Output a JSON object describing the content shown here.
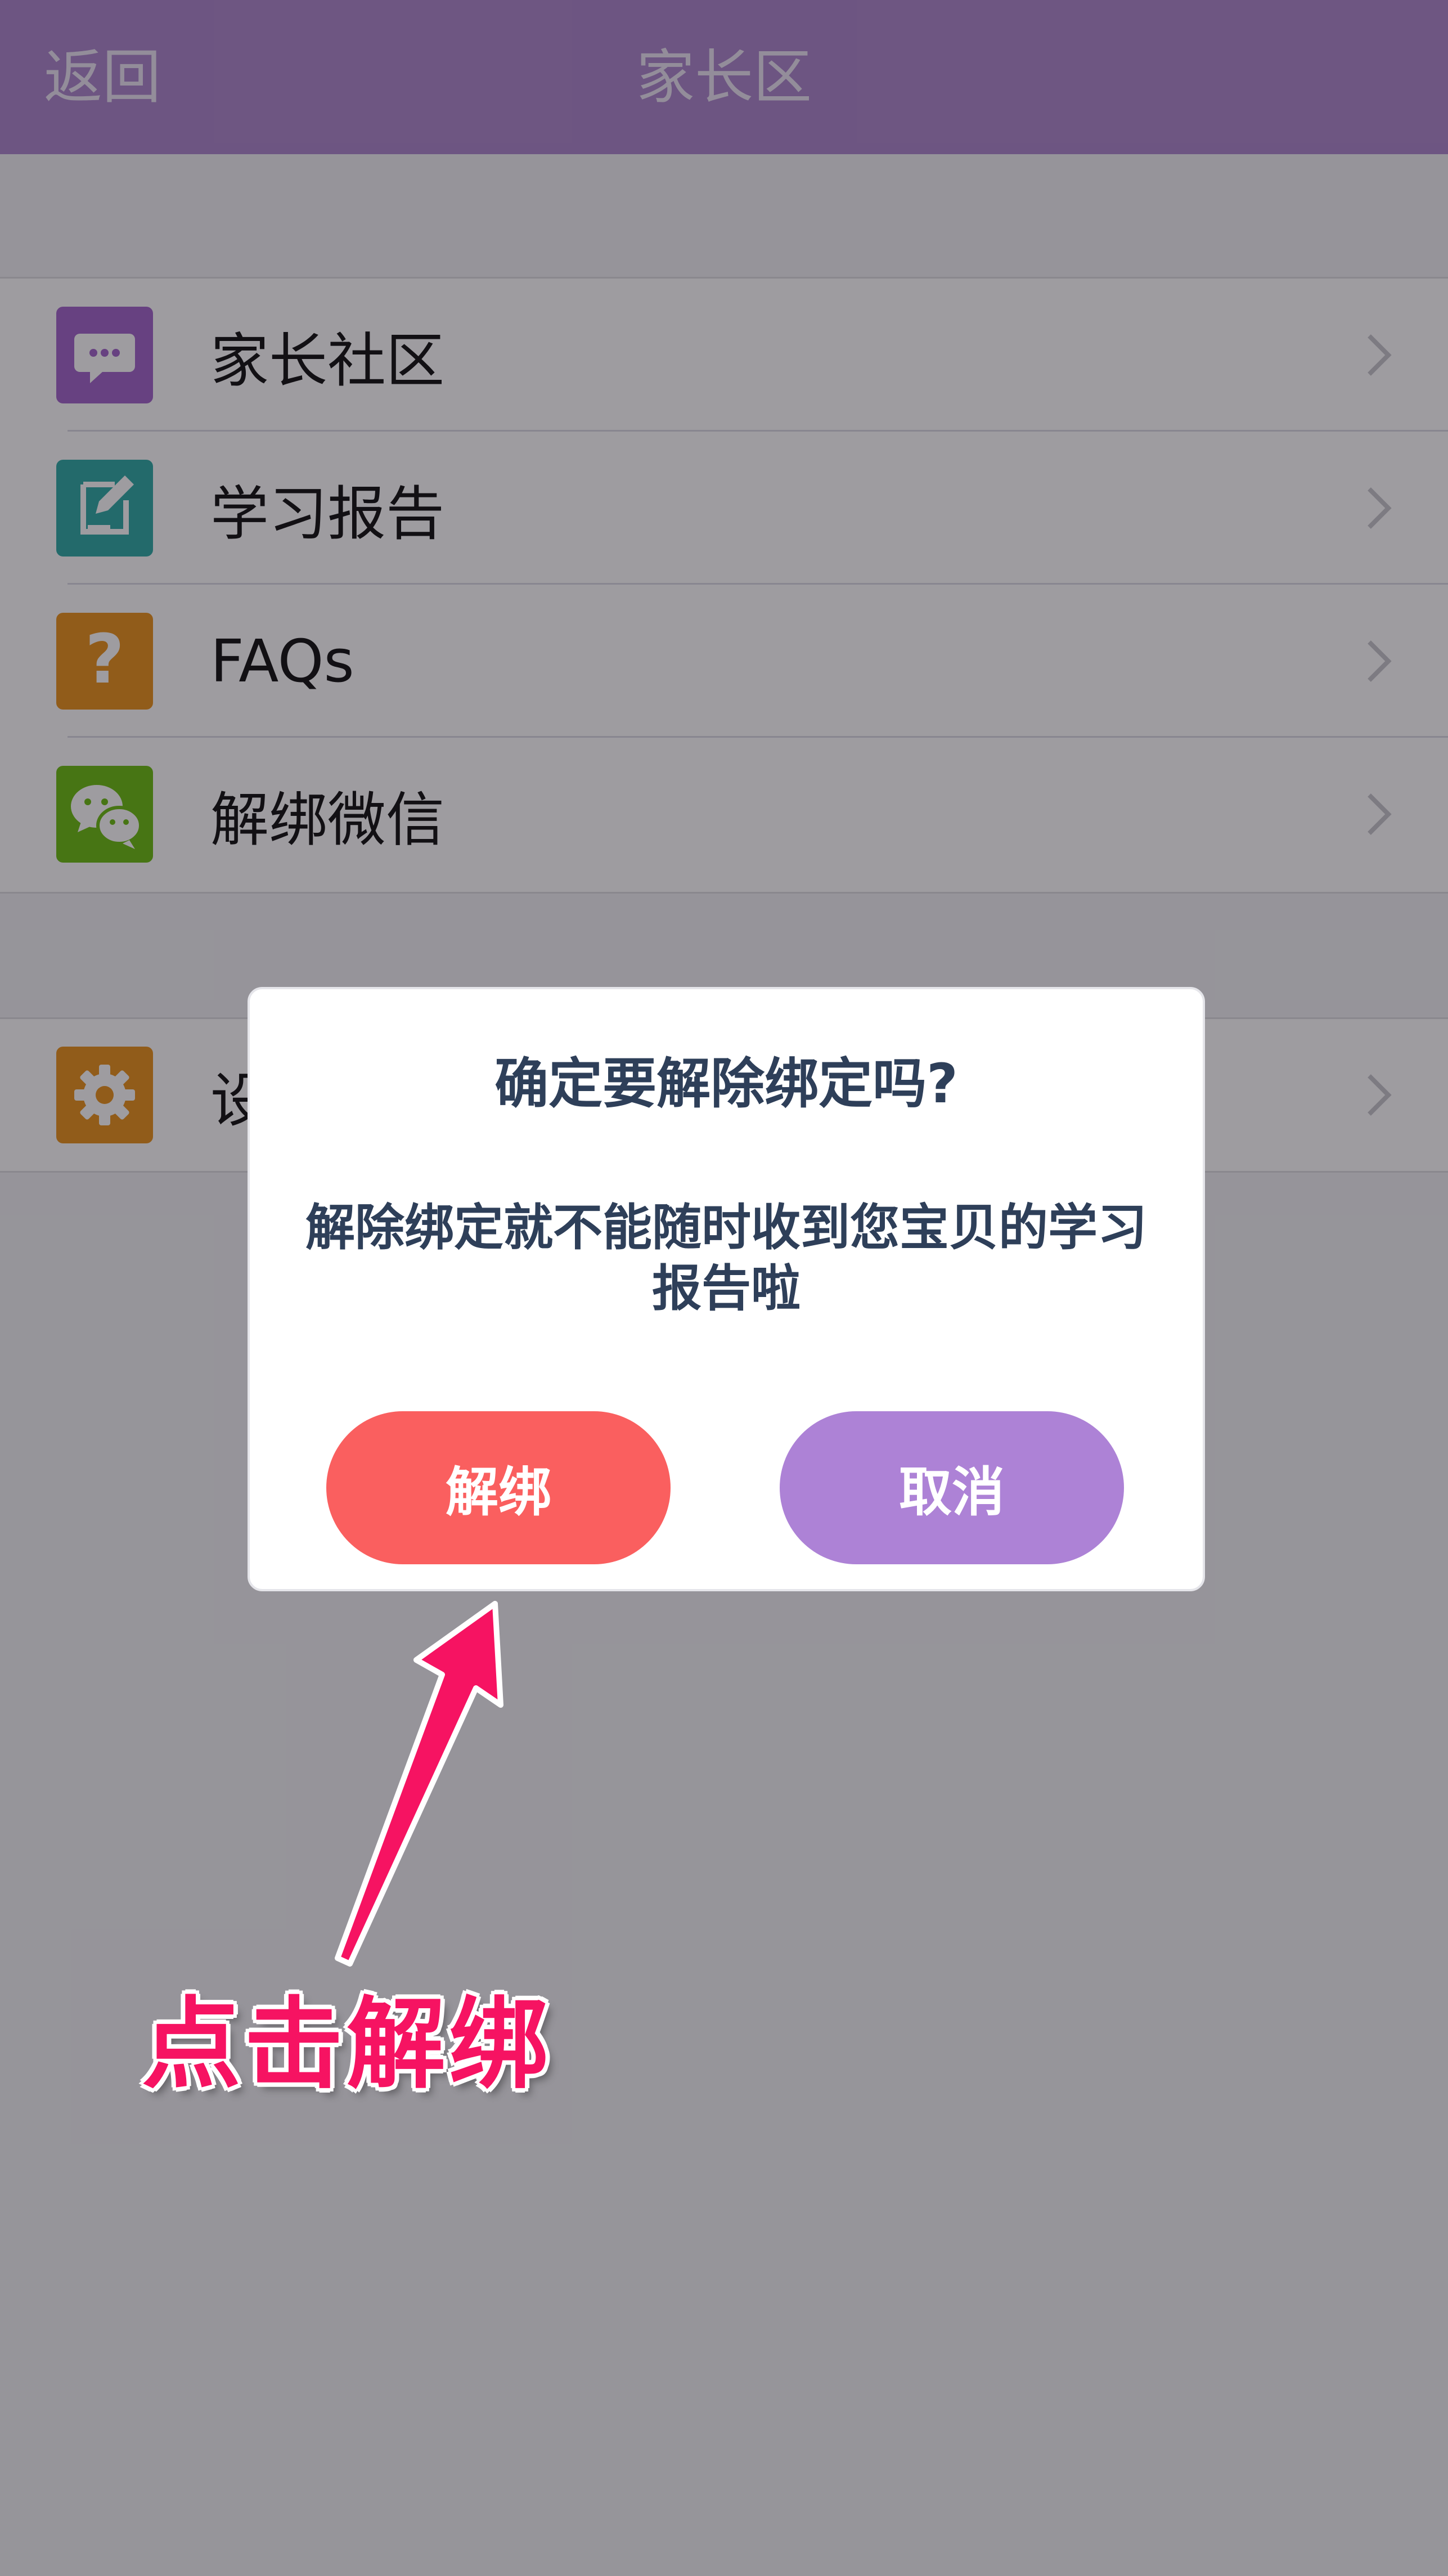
{
  "navbar": {
    "back_label": "返回",
    "title": "家长区"
  },
  "menu": {
    "items": [
      {
        "label": "家长社区",
        "icon": "chat-bubble-icon",
        "color": "#9B59C6"
      },
      {
        "label": "学习报告",
        "icon": "edit-report-icon",
        "color": "#1FA59E"
      },
      {
        "label": "FAQs",
        "icon": "question-mark-icon",
        "color": "#E88A0B"
      },
      {
        "label": "解绑微信",
        "icon": "wechat-icon",
        "color": "#62B900"
      }
    ],
    "settings": {
      "label": "设置",
      "icon": "gear-icon",
      "color": "#E88A0B"
    }
  },
  "dialog": {
    "title": "确定要解除绑定吗?",
    "message": "解除绑定就不能随时收到您宝贝的学习报告啦",
    "unbind_label": "解绑",
    "cancel_label": "取消"
  },
  "annotation": {
    "text": "点击解绑",
    "color": "#F61362"
  }
}
